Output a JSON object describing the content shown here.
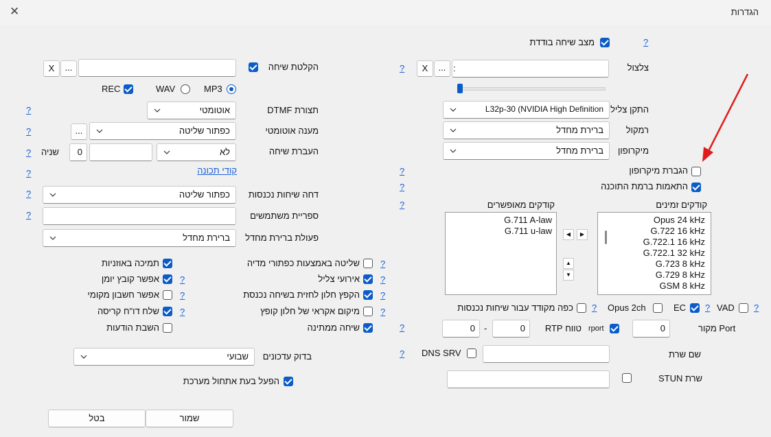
{
  "window": {
    "title": "הגדרות"
  },
  "help": "?",
  "single_call": {
    "label": "מצב שיחה בודדת",
    "checked": true
  },
  "ringtone": {
    "label": "צלצול",
    "value": ":"
  },
  "buttons": {
    "x": "X",
    "dots": "..."
  },
  "recording": {
    "label": "הקלטת שיחה",
    "checked": true,
    "rec": "REC",
    "wav": "WAV",
    "mp3": "MP3",
    "format": "MP3"
  },
  "ring_device": {
    "label": "התקן צליל",
    "value": "L32p-30 (NVIDIA High Definition"
  },
  "speaker": {
    "label": "רמקול",
    "value": "ברירת מחדל"
  },
  "microphone": {
    "label": "מיקרופון",
    "value": "ברירת מחדל"
  },
  "dtmf": {
    "label": "תצורת DTMF",
    "value": "אוטומטי"
  },
  "auto_answer": {
    "label": "מענה אוטומטי",
    "value": "כפתור שליטה"
  },
  "call_forward": {
    "label": "העברת שיחה",
    "value": "לא",
    "seconds_label": "שניה",
    "seconds": "0"
  },
  "shortcodes": {
    "label": "קודי תכונה"
  },
  "reject_incoming": {
    "label": "דחה שיחות נכנסות",
    "value": "כפתור שליטה"
  },
  "directory": {
    "label": "ספריית משתמשים",
    "value": ""
  },
  "default_action": {
    "label": "פעולת ברירת מחדל",
    "value": "ברירת מחדל"
  },
  "mic_boost": {
    "label": "הגברת מיקרופון",
    "checked": false
  },
  "software_adjust": {
    "label": "התאמות ברמת התוכנה",
    "checked": true
  },
  "codecs": {
    "available_label": "קודקים זמינים",
    "enabled_label": "קודקים מאופשרים",
    "available": [
      "Opus 24 kHz",
      "G.722 16 kHz",
      "G.722.1 16 kHz",
      "G.722.1 32 kHz",
      "G.723 8 kHz",
      "G.729 8 kHz",
      "GSM 8 kHz"
    ],
    "enabled": [
      "G.711 A-law",
      "G.711 u-law"
    ]
  },
  "left_checks": [
    {
      "label": "תמיכה באוזניות",
      "checked": true,
      "help": false
    },
    {
      "label": "אפשר קובץ יומן",
      "checked": true,
      "help": true
    },
    {
      "label": "אפשר חשבון מקומי",
      "checked": false,
      "help": true
    },
    {
      "label": "שלח דו\"ח קריסה",
      "checked": true,
      "help": true
    },
    {
      "label": "השבת הודעות",
      "checked": false,
      "help": false
    }
  ],
  "mid_checks": [
    {
      "label": "שליטה באמצעות כפתורי מדיה",
      "checked": false
    },
    {
      "label": "אירועי צליל",
      "checked": true
    },
    {
      "label": "הקפץ חלון לחזית בשיחה נכנסת",
      "checked": true
    },
    {
      "label": "מיקום אקראי של חלון קופץ",
      "checked": false
    },
    {
      "label": "שיחה ממתינה",
      "checked": true
    }
  ],
  "force_codec": {
    "label": "כפה מקודד עבור שיחות נכנסות",
    "checked": false
  },
  "opus2ch": {
    "label": "Opus 2ch",
    "checked": false
  },
  "ec": {
    "label": "EC",
    "checked": true
  },
  "vad": {
    "label": "VAD",
    "checked": false
  },
  "port": {
    "label": "Port מקור",
    "value": "0"
  },
  "rport": {
    "label": "rport",
    "checked": true
  },
  "rtp": {
    "label": "טווח RTP",
    "from": "0",
    "to": "0",
    "sep": "-"
  },
  "dns_srv": {
    "label": "DNS SRV",
    "checked": false
  },
  "server_name": {
    "label": "שם שרת",
    "value": ""
  },
  "stun": {
    "label": "שרת STUN",
    "checked": false,
    "value": ""
  },
  "updates": {
    "label": "בדוק עדכונים",
    "value": "שבועי"
  },
  "run_startup": {
    "label": "הפעל בעת אתחול מערכת",
    "checked": true
  },
  "save": "שמור",
  "cancel": "בטל"
}
